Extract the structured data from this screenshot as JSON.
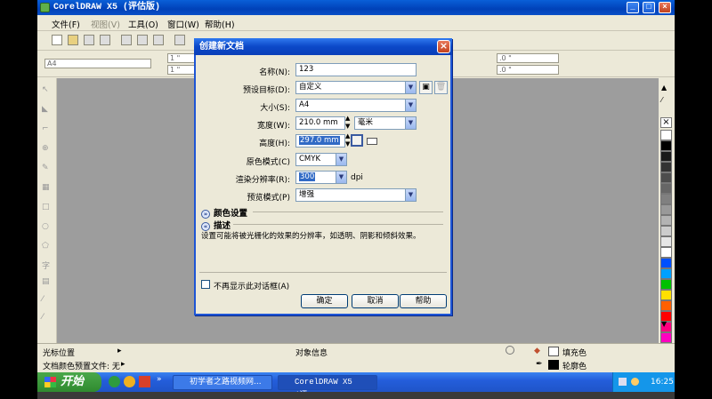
{
  "window": {
    "title": "CorelDRAW X5 (评估版)"
  },
  "menu": [
    "文件(F)",
    "视图(V)",
    "工具(O)",
    "窗口(W)",
    "帮助(H)"
  ],
  "toolbar2": {
    "paper": "A4",
    "dim1": "1 \"",
    "dim2": "1 \"",
    "nudge1": ".0 \"",
    "nudge2": ".0 \""
  },
  "dialog": {
    "title": "创建新文档",
    "fields": {
      "name": {
        "label": "名称(N):",
        "value": "123"
      },
      "preset": {
        "label": "预设目标(D):",
        "value": "自定义"
      },
      "size": {
        "label": "大小(S):",
        "value": "A4"
      },
      "width": {
        "label": "宽度(W):",
        "value": "210.0 mm",
        "unit": "毫米"
      },
      "height": {
        "label": "高度(H):",
        "value": "297.0 mm"
      },
      "color_mode": {
        "label": "原色模式(C)",
        "value": "CMYK"
      },
      "resolution": {
        "label": "渲染分辨率(R):",
        "value": "300",
        "unit": "dpi"
      },
      "preview": {
        "label": "预览模式(P)",
        "value": "增强"
      }
    },
    "color_settings": "颜色设置",
    "description_header": "描述",
    "description": "设置可能将被光栅化的效果的分辨率，如透明、阴影和倾斜效果。",
    "dont_show": "不再显示此对话框(A)",
    "buttons": {
      "ok": "确定",
      "cancel": "取消",
      "help": "帮助"
    }
  },
  "status": {
    "cursor_pos": "光标位置",
    "object_info": "对象信息",
    "doc_color": "文档颜色预置文件: 无",
    "fill": "填充色",
    "outline": "轮廓色"
  },
  "taskbar": {
    "start": "开始",
    "tasks": [
      "初学者之路视频网...",
      "CorelDRAW X5 (评..."
    ],
    "clock": "16:25"
  },
  "palette_colors": [
    "#ffffff",
    "#000000",
    "#1a1a1a",
    "#333333",
    "#4d4d4d",
    "#666666",
    "#808080",
    "#999999",
    "#b3b3b3",
    "#cccccc",
    "#e6e6e6",
    "#ffffff",
    "#0050ff",
    "#00a0ff",
    "#00c000",
    "#ffe000",
    "#ff6000",
    "#ff0000",
    "#ff0080",
    "#ff00c0",
    "#c000ff"
  ]
}
